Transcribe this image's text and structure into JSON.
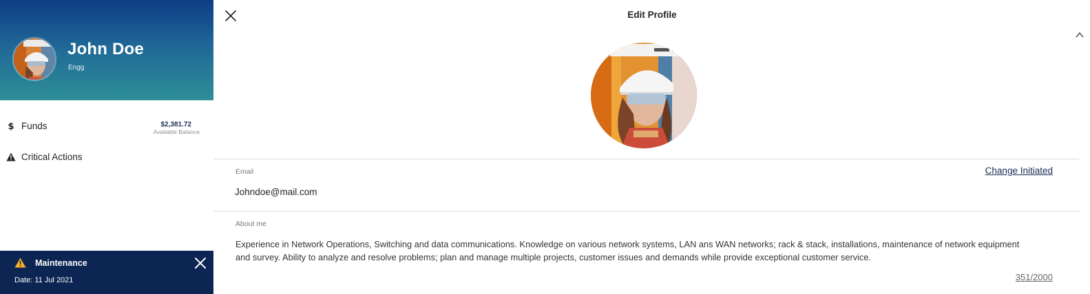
{
  "sidebar": {
    "user_name": "John Doe",
    "user_role": "Engg",
    "nav": [
      {
        "label": "Funds",
        "icon": "dollar-icon"
      },
      {
        "label": "Critical Actions",
        "icon": "warning-icon"
      }
    ],
    "balance": {
      "amount": "$2,381.72",
      "caption": "Available Balance"
    },
    "maintenance": {
      "title": "Maintenance",
      "date": "Date: 11 Jul 2021"
    }
  },
  "main": {
    "title": "Edit Profile",
    "email": {
      "label": "Email",
      "value": "Johndoe@mail.com",
      "action": "Change Initiated"
    },
    "about": {
      "label": "About me",
      "text": "Experience in Network Operations, Switching and data communications. Knowledge on various network systems, LAN ans WAN networks; rack & stack, installations, maintenance of network equipment and survey. Ability to analyze and resolve problems; plan and manage multiple projects, customer issues and demands while provide exceptional customer service.",
      "count": "351/2000"
    }
  },
  "colors": {
    "header_top": "#0e3d86",
    "header_bottom": "#2e8f97",
    "maintenance_bg": "#0c2553",
    "warning": "#f5b323",
    "link": "#1d2c57"
  }
}
